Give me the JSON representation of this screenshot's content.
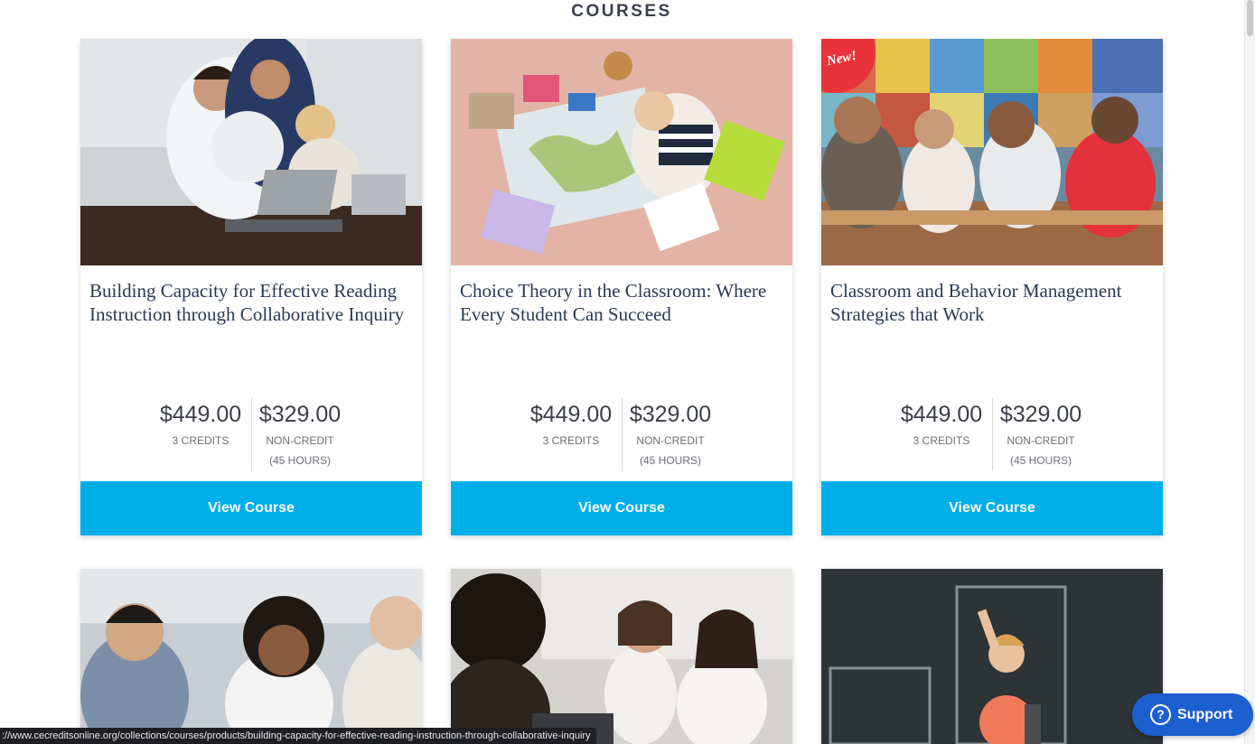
{
  "section": {
    "title": "COURSES"
  },
  "courses": [
    {
      "title": "Building Capacity for Effective Reading Instruction through Collaborative Inquiry",
      "credit_price": "$449.00",
      "credit_label": "3 CREDITS",
      "noncredit_price": "$329.00",
      "noncredit_label": "NON-CREDIT",
      "noncredit_hours": "(45 HOURS)",
      "button": "View Course"
    },
    {
      "title": "Choice Theory in the Classroom: Where Every Student Can Succeed",
      "credit_price": "$449.00",
      "credit_label": "3 CREDITS",
      "noncredit_price": "$329.00",
      "noncredit_label": "NON-CREDIT",
      "noncredit_hours": "(45 HOURS)",
      "button": "View Course"
    },
    {
      "title": "Classroom and Behavior Management Strategies that Work",
      "badge": "New!",
      "credit_price": "$449.00",
      "credit_label": "3 CREDITS",
      "noncredit_price": "$329.00",
      "noncredit_label": "NON-CREDIT",
      "noncredit_hours": "(45 HOURS)",
      "button": "View Course"
    }
  ],
  "status_url": "://www.cecreditsonline.org/collections/courses/products/building-capacity-for-effective-reading-instruction-through-collaborative-inquiry",
  "support": {
    "label": "Support",
    "icon": "?"
  },
  "colors": {
    "button": "#00aee9",
    "badge": "#e8333a",
    "support": "#1c5fcf",
    "title_text": "#2b3a55"
  }
}
